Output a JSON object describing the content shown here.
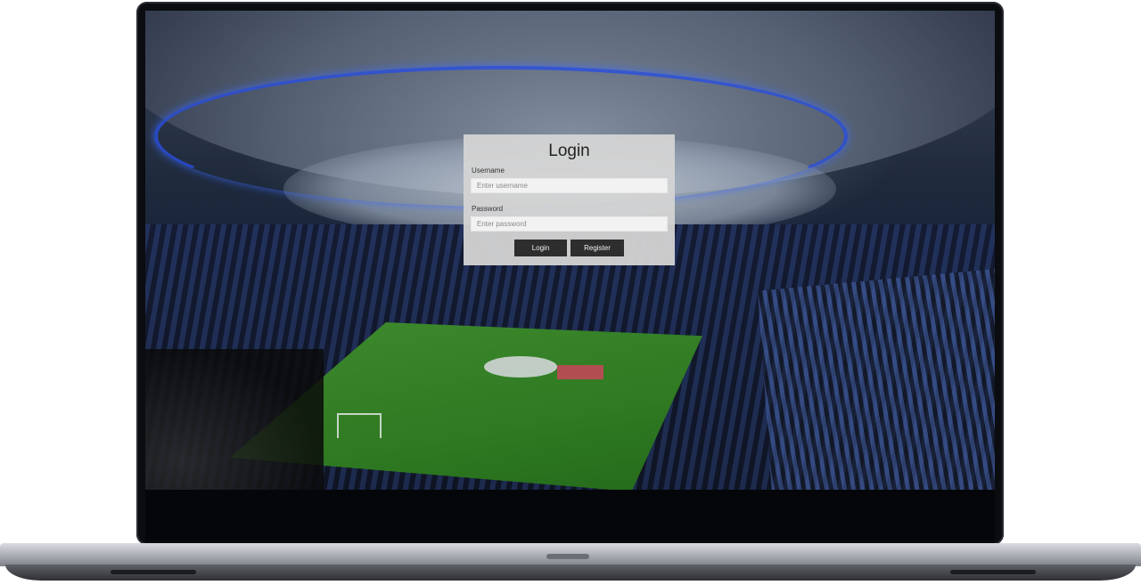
{
  "login": {
    "title": "Login",
    "username_label": "Username",
    "username_placeholder": "Enter username",
    "password_label": "Password",
    "password_placeholder": "Enter password",
    "login_button": "Login",
    "register_button": "Register"
  },
  "colors": {
    "panel_bg": "#d4d4d4",
    "button_bg": "#2e2e2e",
    "bezel": "#0b0c10"
  }
}
